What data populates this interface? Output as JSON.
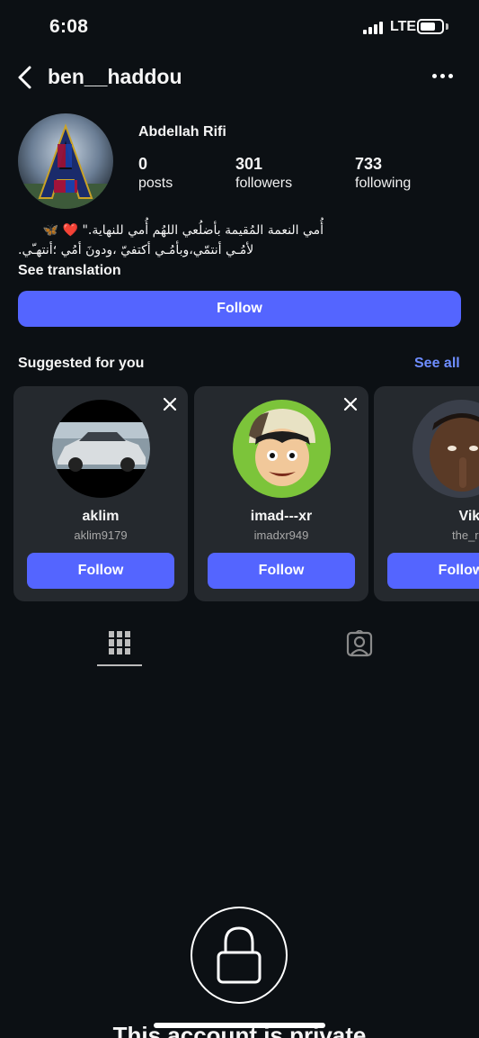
{
  "status_bar": {
    "time": "6:08",
    "network": "LTE",
    "battery_level": 0.6
  },
  "header": {
    "username": "ben__haddou"
  },
  "profile": {
    "full_name": "Abdellah Rifi",
    "stats": [
      {
        "value": "0",
        "label": "posts"
      },
      {
        "value": "301",
        "label": "followers"
      },
      {
        "value": "733",
        "label": "following"
      }
    ],
    "bio_line1": "أُمي النعمة المُقيمة بأضلُعي اللهُم أُمي للنهاية.\" ❤️ 🦋",
    "bio_line2": "لأمُـي أنتمّي،وبأمُـي أكتفيّ ،ودونَ أمُي ؛أنتهـّي.",
    "see_translation": "See translation",
    "follow_label": "Follow"
  },
  "suggested": {
    "title": "Suggested for you",
    "see_all": "See all",
    "cards": [
      {
        "name": "aklim",
        "handle": "aklim9179",
        "follow": "Follow"
      },
      {
        "name": "imad---xr",
        "handle": "imadxr949",
        "follow": "Follow"
      },
      {
        "name": "Viktor",
        "handle": "the_real.vi",
        "follow": "Follow"
      }
    ]
  },
  "private": {
    "message": "This account is private"
  },
  "colors": {
    "accent": "#5465ff",
    "link": "#6e8dff",
    "background": "#0c1014",
    "card": "#25292e"
  }
}
